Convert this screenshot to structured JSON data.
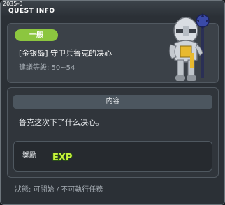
{
  "window": {
    "quest_id": "2035-0",
    "title": "QUEST INFO"
  },
  "quest": {
    "category": "一般",
    "name": "[金银岛] 守卫兵鲁克的决心",
    "recommended_level": "建議等級: 50~54",
    "npc_icon": "guard-knight-icon"
  },
  "content": {
    "header": "内容",
    "text": "鲁克这次下了什么决心。"
  },
  "reward": {
    "label": "獎勵",
    "exp_icon": "exp-icon",
    "exp_text": "EXP"
  },
  "status": {
    "text": "狀態: 可開始 / 不可執行任務"
  },
  "colors": {
    "category_badge": "#8cc63f",
    "exp_text": "#c8f23c",
    "panel_bg": "#3b4148",
    "window_bg": "#2b3036"
  }
}
